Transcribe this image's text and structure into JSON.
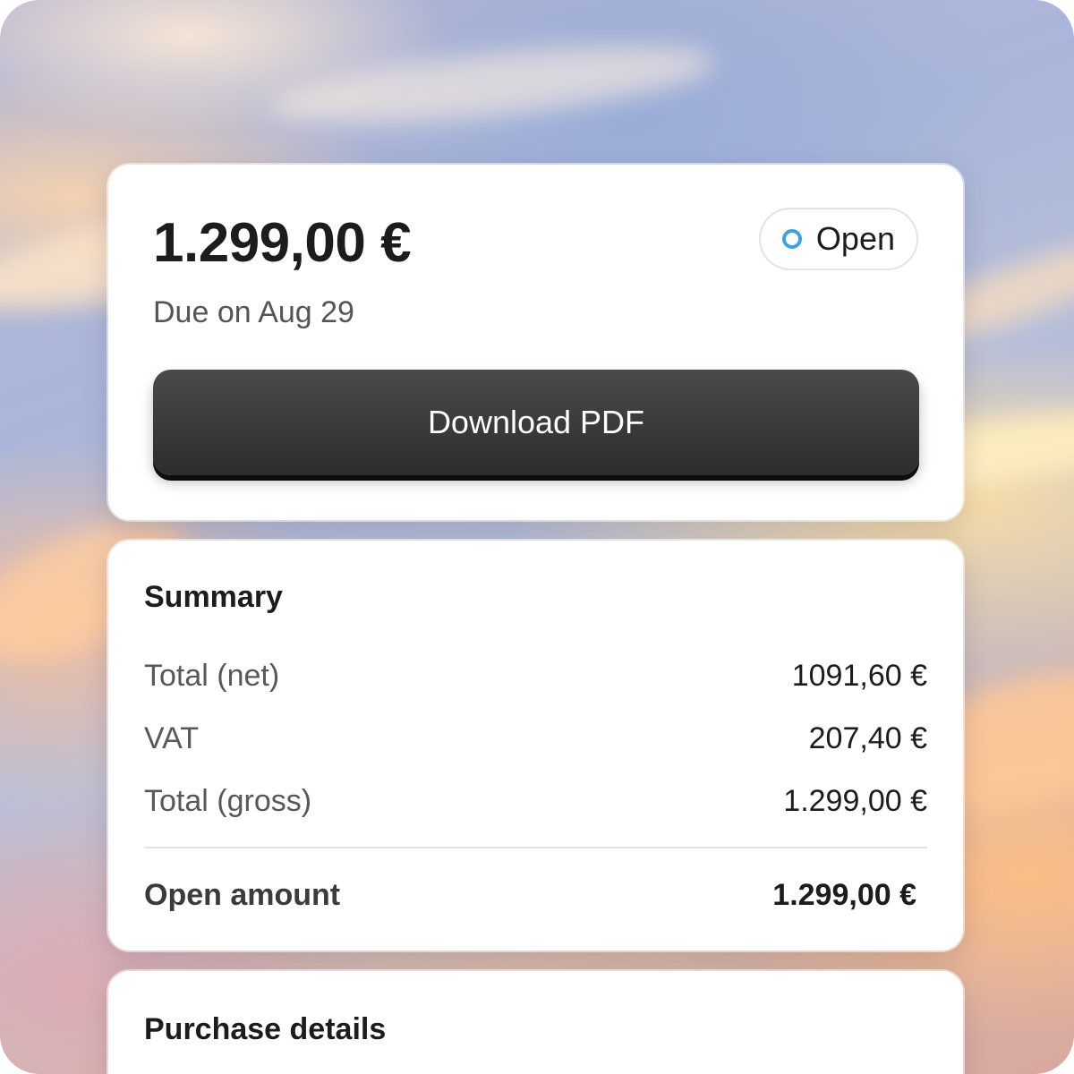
{
  "invoice": {
    "amount": "1.299,00 €",
    "due_text": "Due on Aug 29",
    "status": {
      "label": "Open",
      "icon": "status-dot-icon",
      "color": "#3ea1e8"
    },
    "download_label": "Download PDF"
  },
  "summary": {
    "title": "Summary",
    "rows": [
      {
        "label": "Total (net)",
        "value": "1091,60 €"
      },
      {
        "label": "VAT",
        "value": "207,40 €"
      },
      {
        "label": "Total (gross)",
        "value": "1.299,00 €"
      }
    ],
    "open_amount": {
      "label": "Open amount",
      "value": "1.299,00 €"
    }
  },
  "purchase": {
    "title": "Purchase details"
  }
}
